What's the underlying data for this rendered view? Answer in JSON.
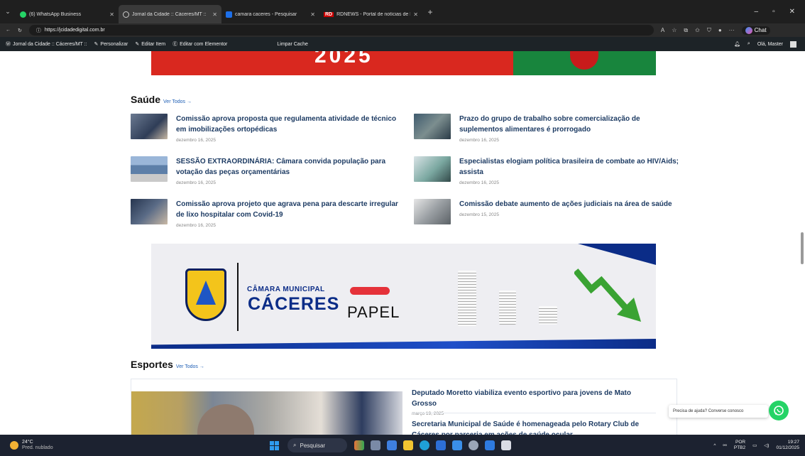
{
  "browser": {
    "tabs": [
      {
        "label": "(6) WhatsApp Business",
        "icon": "whatsapp-icon"
      },
      {
        "label": "Jornal da Cidade :: Cáceres/MT ::",
        "icon": "globe-icon",
        "active": true
      },
      {
        "label": "camara caceres - Pesquisar",
        "icon": "bing-icon"
      },
      {
        "label": "RDNEWS - Portal de notícias de M",
        "icon": "rd-icon"
      }
    ],
    "url": "https://jcidadedigital.com.br",
    "chat_label": "Chat"
  },
  "wp_admin_bar": {
    "site": "Jornal da Cidade :: Cáceres/MT ::",
    "items": [
      "Personalizar",
      "Editar Item",
      "Editar com Elementor",
      "Limpar Cache"
    ],
    "greeting": "Olá, Master"
  },
  "top_banner_text": "2025",
  "saude": {
    "title": "Saúde",
    "ver_todos": "Ver Todos →",
    "news": [
      {
        "title": "Comissão aprova proposta que regulamenta atividade de técnico em imobilizações ortopédicas",
        "date": "dezembro 16, 2025"
      },
      {
        "title": "Prazo do grupo de trabalho sobre comercialização de suplementos alimentares é prorrogado",
        "date": "dezembro 16, 2025"
      },
      {
        "title": "SESSÃO EXTRAORDINÁRIA: Câmara convida população para votação das peças orçamentárias",
        "date": "dezembro 16, 2025"
      },
      {
        "title": "Especialistas elogiam política brasileira de combate ao HIV/Aids; assista",
        "date": "dezembro 16, 2025"
      },
      {
        "title": "Comissão aprova projeto que agrava pena para descarte irregular de lixo hospitalar com Covid-19",
        "date": "dezembro 16, 2025"
      },
      {
        "title": "Comissão debate aumento de ações judiciais na área de saúde",
        "date": "dezembro 15, 2025"
      }
    ]
  },
  "ad": {
    "line1": "CÂMARA MUNICIPAL",
    "line2": "CÁCERES",
    "word": "PAPEL"
  },
  "esportes": {
    "title": "Esportes",
    "ver_todos": "Ver Todos →",
    "news": [
      {
        "title": "Deputado Moretto viabiliza evento esportivo para jovens de Mato Grosso",
        "date": "março 19, 2025"
      },
      {
        "title": "Secretaria Municipal de Saúde é homenageada pelo Rotary Club de Cáceres por parceria em ações de saúde ocular",
        "date": ""
      }
    ]
  },
  "help": {
    "text": "Precisa de ajuda? Converse conosco"
  },
  "taskbar": {
    "temp": "24°C",
    "weather": "Pred. nublado",
    "search": "Pesquisar",
    "lang1": "POR",
    "lang2": "PTB2",
    "time": "19:27",
    "date": "01/12/2025"
  },
  "colors": {
    "accent": "#1d3b63",
    "link": "#1f5fb5",
    "whatsapp": "#25d366"
  }
}
